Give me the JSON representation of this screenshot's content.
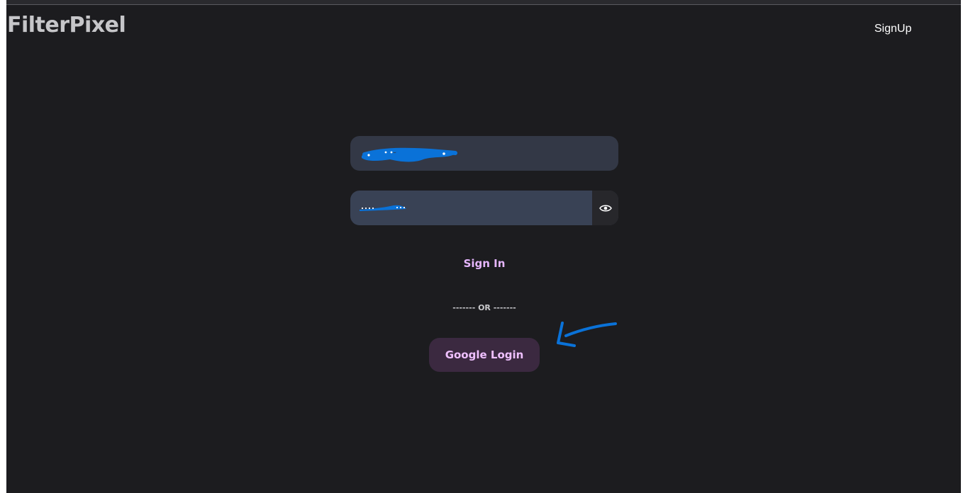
{
  "header": {
    "brand": "FilterPixel",
    "signup_label": "SignUp"
  },
  "form": {
    "email": {
      "value": "",
      "placeholder": ""
    },
    "password": {
      "value": "",
      "placeholder": ""
    },
    "sign_in_label": "Sign In",
    "or_divider": "------- OR -------",
    "google_login_label": "Google Login"
  },
  "icons": {
    "password_toggle": "eye-icon"
  },
  "colors": {
    "background": "#1c1c1f",
    "input_background": "#333846",
    "accent_text": "#e6b6ff",
    "google_button_background": "#3b2940",
    "annotation_blue": "#0a72d8"
  }
}
